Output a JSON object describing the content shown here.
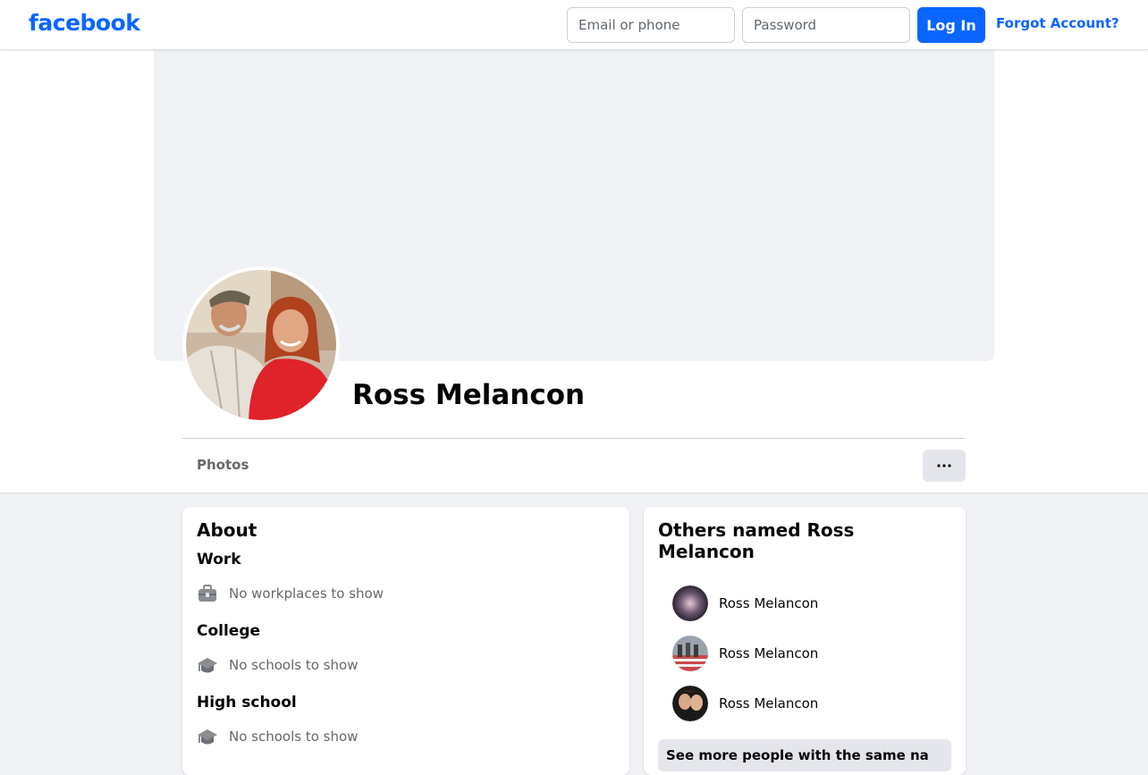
{
  "topbar": {
    "logo": "facebook",
    "email_placeholder": "Email or phone",
    "password_placeholder": "Password",
    "login_label": "Log In",
    "forgot_label": "Forgot Account?"
  },
  "profile": {
    "name": "Ross Melancon",
    "tabs": [
      "Photos"
    ],
    "more_label": "•••"
  },
  "about": {
    "title": "About",
    "sections": [
      {
        "heading": "Work",
        "text": "No workplaces to show",
        "icon": "briefcase-icon"
      },
      {
        "heading": "College",
        "text": "No schools to show",
        "icon": "graduation-cap-icon"
      },
      {
        "heading": "High school",
        "text": "No schools to show",
        "icon": "graduation-cap-icon"
      }
    ]
  },
  "others": {
    "title": "Others named Ross Melancon",
    "people": [
      {
        "name": "Ross Melancon"
      },
      {
        "name": "Ross Melancon"
      },
      {
        "name": "Ross Melancon"
      }
    ],
    "see_more_label": "See more people with the same na"
  },
  "colors": {
    "brand": "#0866ff",
    "page_bg": "#f0f2f5",
    "secondary_text": "#65676b"
  }
}
